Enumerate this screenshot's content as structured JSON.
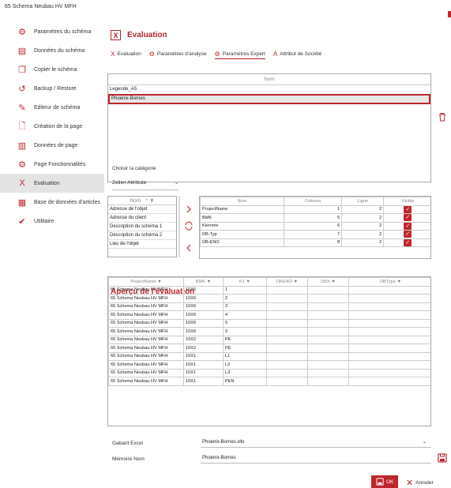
{
  "window": {
    "title": "65 Schema Neubau HV MFH"
  },
  "sidebar": {
    "items": [
      {
        "label": "Paramètres du schéma",
        "icon": "gears-icon"
      },
      {
        "label": "Données du schéma",
        "icon": "document-icon"
      },
      {
        "label": "Copier le schéma",
        "icon": "copy-icon"
      },
      {
        "label": "Backup / Restore",
        "icon": "restore-icon"
      },
      {
        "label": "Editeur de schéma",
        "icon": "pencil-icon"
      },
      {
        "label": "Création de la page",
        "icon": "new-page-icon"
      },
      {
        "label": "Données de page",
        "icon": "page-data-icon"
      },
      {
        "label": "Page Fonctionnalités",
        "icon": "function-icon"
      },
      {
        "label": "Evaluation",
        "icon": "excel-icon"
      },
      {
        "label": "Base de données d'articles",
        "icon": "database-edit-icon"
      },
      {
        "label": "Utilitaire",
        "icon": "tool-icon"
      }
    ]
  },
  "header": {
    "title": "Evaluation"
  },
  "tabs": [
    {
      "label": "Evaluation",
      "icon": "excel-icon"
    },
    {
      "label": "Paramètres d'analyse",
      "icon": "gears-icon"
    },
    {
      "label": "Paramètres Expert",
      "icon": "gears-icon"
    },
    {
      "label": "Attribut de Société",
      "icon": "text-icon"
    }
  ],
  "nom_list": {
    "header": "Nom",
    "items": [
      "Legende_A5",
      "Phoenix-Bornes"
    ]
  },
  "category": {
    "label": "Choisir la catégorie",
    "value": "Zeilen Attribute"
  },
  "left_list": {
    "header": "Nom",
    "items": [
      "Adresse de l'objet",
      "Adresse du client",
      "Description du schéma 1",
      "Description du schéma 2",
      "Lieu de l'objet"
    ]
  },
  "right_table": {
    "headers": [
      "Nom",
      "Colonne",
      "Ligne",
      "Visible"
    ],
    "rows": [
      {
        "nom": "ProjectName",
        "col": "1",
        "ligne": "2"
      },
      {
        "nom": "BMK",
        "col": "5",
        "ligne": "2"
      },
      {
        "nom": "Klemme",
        "col": "6",
        "ligne": "2"
      },
      {
        "nom": "DB-Typ",
        "col": "7",
        "ligne": "2"
      },
      {
        "nom": "DB-ENO",
        "col": "8",
        "ligne": "2"
      }
    ]
  },
  "preview": {
    "title": "Aperçu de l'évaluation",
    "headers": [
      "ProjectName",
      "BMK",
      "K1",
      "DBENO",
      "DBX",
      "DBType"
    ],
    "rows": [
      [
        "65 Schema Neubau HV MFH",
        "10X6",
        "1"
      ],
      [
        "65 Schema Neubau HV MFH",
        "10X6",
        "2"
      ],
      [
        "65 Schema Neubau HV MFH",
        "10X6",
        "3"
      ],
      [
        "65 Schema Neubau HV MFH",
        "10X6",
        "4"
      ],
      [
        "65 Schema Neubau HV MFH",
        "10X6",
        "5"
      ],
      [
        "65 Schema Neubau HV MFH",
        "10X6",
        "0"
      ],
      [
        "65 Schema Neubau HV MFH",
        "10X2",
        "PE"
      ],
      [
        "65 Schema Neubau HV MFH",
        "10X2",
        "PE"
      ],
      [
        "65 Schema Neubau HV MFH",
        "10X1",
        "L1"
      ],
      [
        "65 Schema Neubau HV MFH",
        "10X1",
        "L2"
      ],
      [
        "65 Schema Neubau HV MFH",
        "10X1",
        "L3"
      ],
      [
        "65 Schema Neubau HV MFH",
        "10X1",
        "PEN"
      ]
    ]
  },
  "form": {
    "gabarit_label": "Gabarit Excel",
    "gabarit_value": "Phoenix-Bornes.xltx",
    "memoire_label": "Mémoire Nom",
    "memoire_value": "Phoenix-Bornes"
  },
  "buttons": {
    "ok": "OK",
    "cancel": "Annuler"
  },
  "colors": {
    "accent": "#c0262d"
  }
}
